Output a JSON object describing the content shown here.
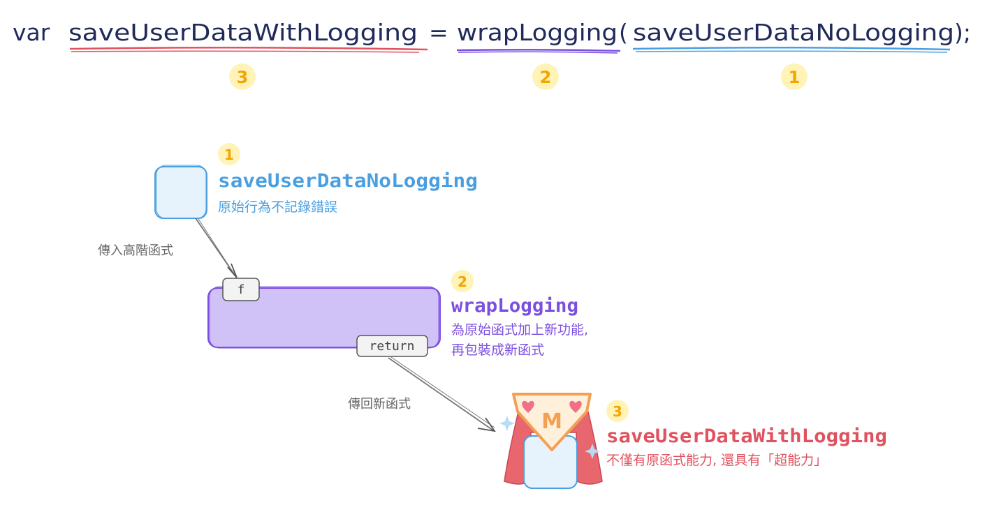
{
  "code_line": {
    "keyword": "var",
    "result_name": "saveUserDataWithLogging",
    "equals": "=",
    "wrapper_name": "wrapLogging",
    "open_paren": "(",
    "arg_name": "saveUserDataNoLogging",
    "close": ");",
    "markers": [
      "3",
      "2",
      "1"
    ]
  },
  "steps": {
    "one": {
      "number": "1",
      "title": "saveUserDataNoLogging",
      "desc": "原始行為不記錄錯誤"
    },
    "two": {
      "number": "2",
      "title": "wrapLogging",
      "desc_line1": "為原始函式加上新功能,",
      "desc_line2": "再包裝成新函式",
      "input_tab": "f",
      "output_tab": "return"
    },
    "three": {
      "number": "3",
      "title": "saveUserDataWithLogging",
      "desc": "不僅有原函式能力, 還具有「超能力」",
      "emblem_letter": "M"
    }
  },
  "arrows": {
    "pass_in_label": "傳入高階函式",
    "return_label": "傳回新函式"
  },
  "colors": {
    "ink": "#1f2a5a",
    "blue": "#4a9fe0",
    "purple": "#7b4fe0",
    "red": "#e0525f",
    "badge": "#fff3b8",
    "badge_text": "#f5a400",
    "blue_fill": "#e6f3fd",
    "purple_fill": "#d0c2f6",
    "cape": "#e8676f",
    "emblem_fill": "#fff0dc",
    "emblem_border": "#f4a052",
    "label_gray": "#666666"
  }
}
